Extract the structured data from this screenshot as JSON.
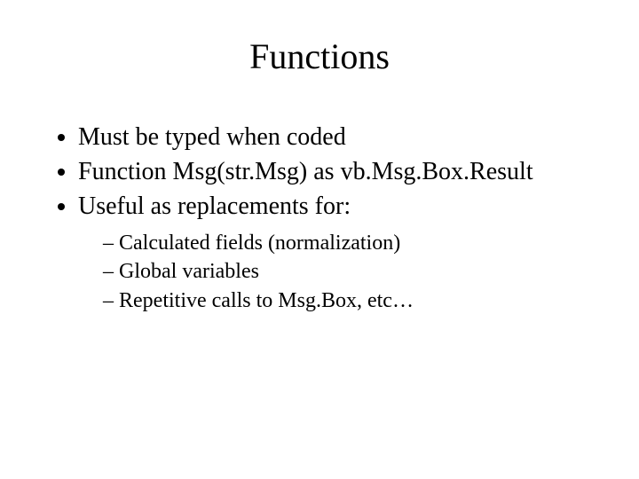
{
  "title": "Functions",
  "bullets": [
    {
      "text": "Must be typed when coded"
    },
    {
      "text": "Function Msg(str.Msg) as vb.Msg.Box.Result"
    },
    {
      "text": "Useful as replacements for:",
      "sub": [
        "Calculated fields (normalization)",
        "Global variables",
        "Repetitive calls to Msg.Box, etc…"
      ]
    }
  ]
}
